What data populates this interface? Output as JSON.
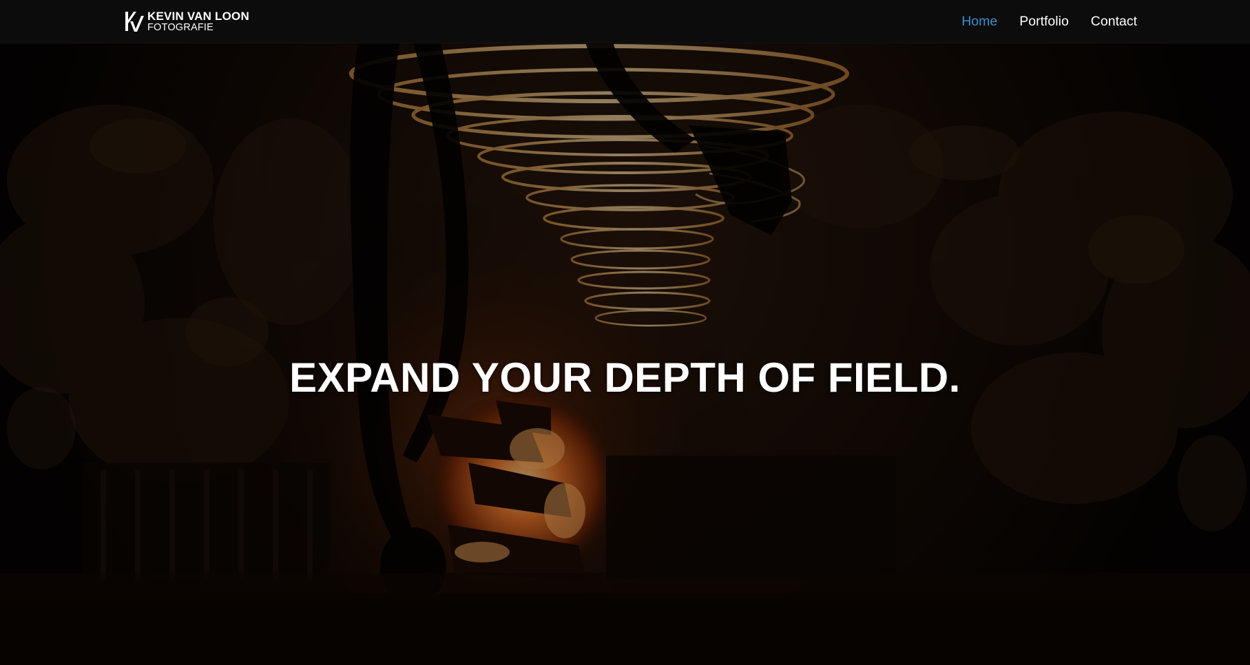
{
  "brand": {
    "logo_icon": "kv-monogram-logo",
    "name_line1": "KEVIN VAN LOON",
    "name_line2": "FOTOGRAFIE"
  },
  "nav": {
    "items": [
      {
        "label": "Home",
        "active": true
      },
      {
        "label": "Portfolio",
        "active": false
      },
      {
        "label": "Contact",
        "active": false
      }
    ]
  },
  "hero": {
    "title": "EXPAND YOUR DEPTH OF FIELD.",
    "background_subject": "light-painting spiral over campfire at night"
  },
  "colors": {
    "navbar_bg": "#0c0c0c",
    "nav_active": "#3a8fd0",
    "nav_text": "#ffffff",
    "hero_text": "#ffffff"
  }
}
